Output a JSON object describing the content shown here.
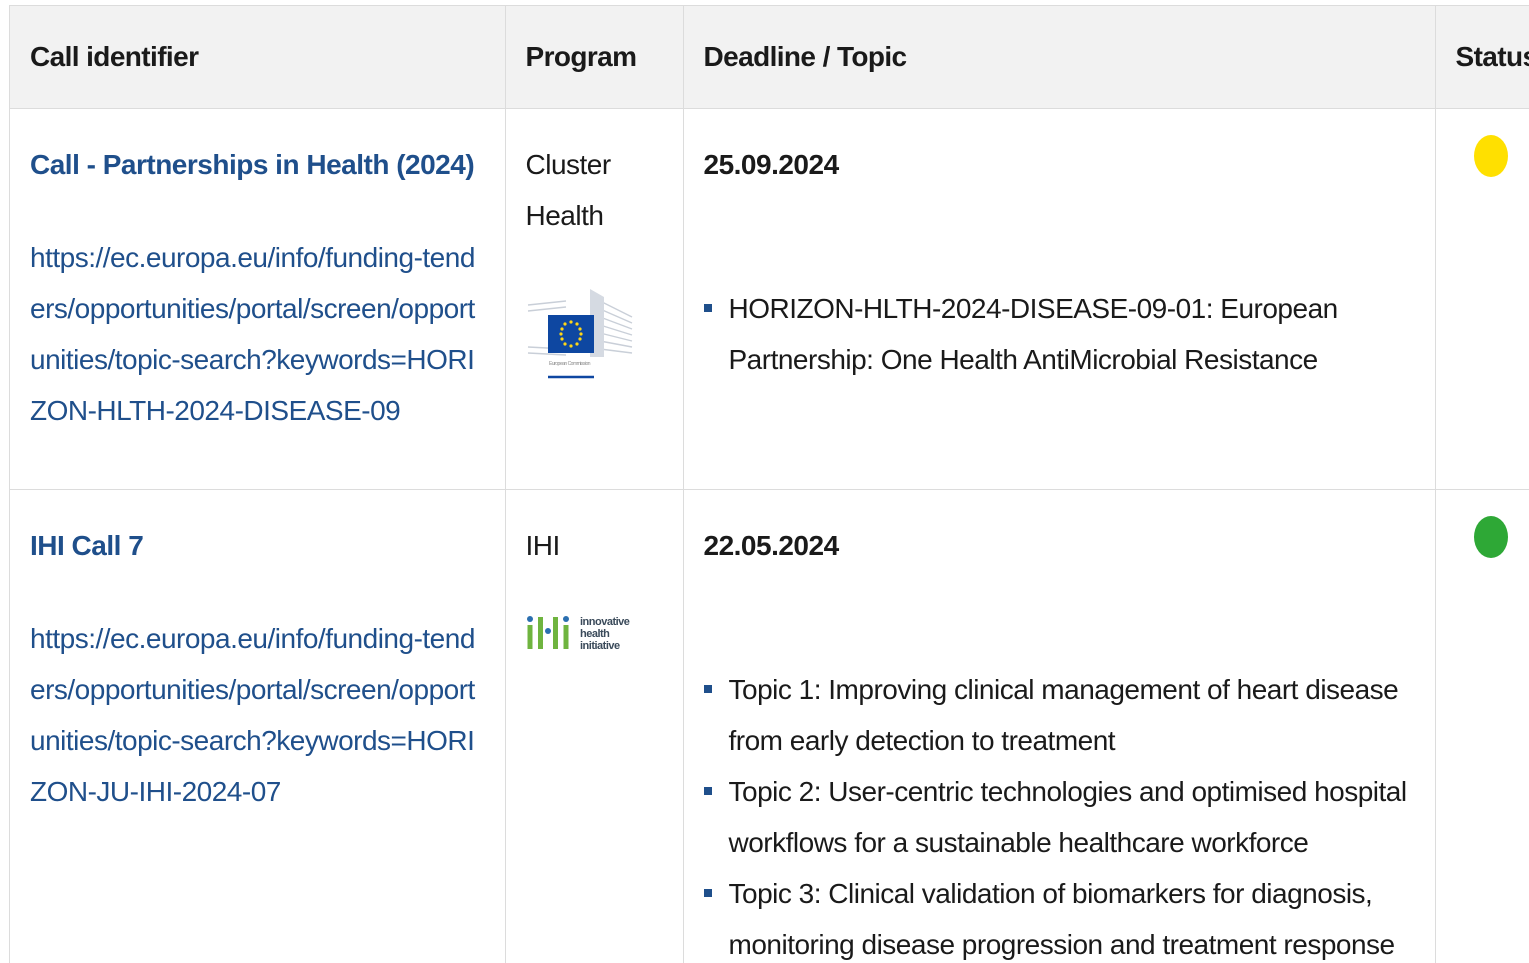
{
  "table": {
    "headers": [
      "Call identifier",
      "Program",
      "Deadline / Topic",
      "Status"
    ],
    "rows": [
      {
        "call_title": "Call - Partnerships in Health (2024)",
        "call_link": "https://ec.europa.eu/info/funding-tenders/opportunities/portal/screen/opportunities/topic-search?keywords=HORIZON-HLTH-2024-DISEASE-09",
        "program": "Cluster Health",
        "program_logo": "european-commission-logo",
        "deadline": "25.09.2024",
        "topics": [
          "HORIZON-HLTH-2024-DISEASE-09-01: European Partnership: One Health AntiMicrobial Resistance"
        ],
        "status_color": "#ffe000"
      },
      {
        "call_title": "IHI Call 7",
        "call_link": "https://ec.europa.eu/info/funding-tenders/opportunities/portal/screen/opportunities/topic-search?keywords=HORIZON-JU-IHI-2024-07",
        "program": "IHI",
        "program_logo": "ihi-logo",
        "deadline": "22.05.2024",
        "topics": [
          "Topic 1: Improving clinical management of heart disease from early detection to treatment",
          "Topic 2: User-centric technologies and optimised hospital workflows for a sustainable healthcare workforce",
          "Topic 3: Clinical validation of biomarkers for diagnosis, monitoring disease progression and treatment response"
        ],
        "status_color": "#2ea836"
      }
    ]
  },
  "logos": {
    "eu_text": "European Commission",
    "ihi_text": [
      "innovative",
      "health",
      "initiative"
    ]
  },
  "colors": {
    "link": "#1f4f8b",
    "header_bg": "#f2f2f2",
    "eu_blue": "#0e47a1",
    "eu_star": "#ffd617",
    "ihi_green": "#6fb43f"
  }
}
